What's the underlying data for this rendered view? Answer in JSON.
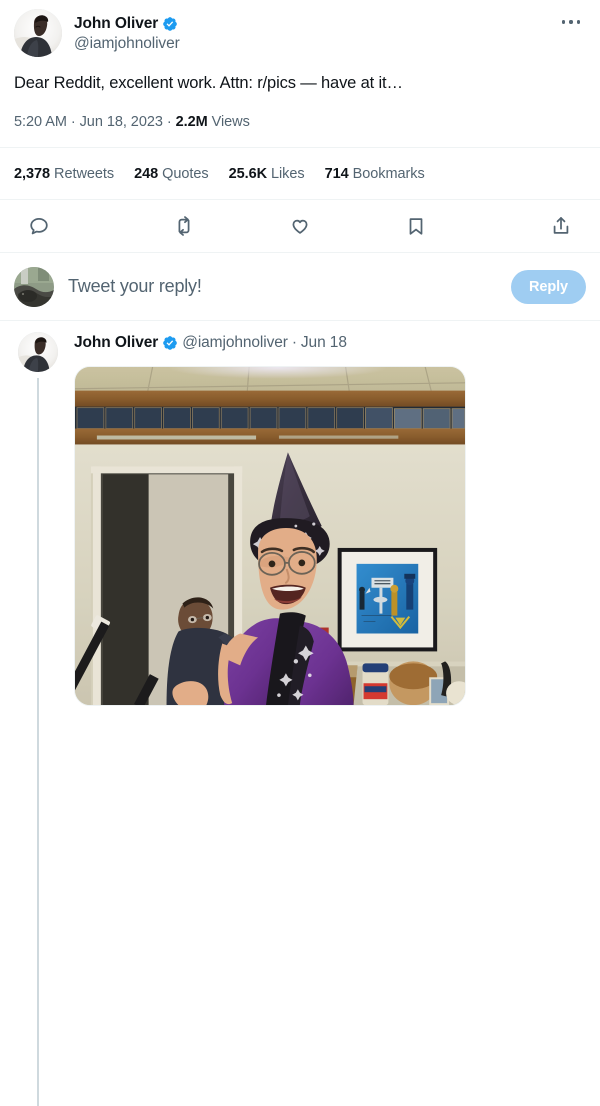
{
  "main_tweet": {
    "author": {
      "display_name": "John Oliver",
      "handle": "@iamjohnoliver",
      "verified_badge": "verified-icon",
      "avatar": "avatar-john-oliver"
    },
    "more_menu": "more-options-icon",
    "text": "Dear Reddit, excellent work. Attn: r/pics — have at it…",
    "meta": {
      "time": "5:20 AM",
      "separator_1": "·",
      "date": "Jun 18, 2023",
      "separator_2": "·",
      "views_count": "2.2M",
      "views_label": "Views"
    },
    "stats": [
      {
        "count": "2,378",
        "label": "Retweets"
      },
      {
        "count": "248",
        "label": "Quotes"
      },
      {
        "count": "25.6K",
        "label": "Likes"
      },
      {
        "count": "714",
        "label": "Bookmarks"
      }
    ],
    "actions": [
      {
        "name": "reply-action",
        "icon": "comment-icon"
      },
      {
        "name": "retweet-action",
        "icon": "retweet-icon"
      },
      {
        "name": "like-action",
        "icon": "heart-icon"
      },
      {
        "name": "bookmark-action",
        "icon": "bookmark-icon"
      },
      {
        "name": "share-action",
        "icon": "share-icon"
      }
    ]
  },
  "composer": {
    "avatar": "avatar-current-user",
    "placeholder": "Tweet your reply!",
    "reply_button_label": "Reply"
  },
  "thread_tweet": {
    "author": {
      "display_name": "John Oliver",
      "handle": "@iamjohnoliver",
      "verified_badge": "verified-icon",
      "avatar": "avatar-john-oliver"
    },
    "separator": "·",
    "date": "Jun 18",
    "more_menu": "more-options-icon",
    "media": {
      "type": "photo",
      "alt": "Man in a purple and black wizard costume with pointed hat holding a magic wand, standing in an office kitchen; a second man stands behind him, a framed blue artwork hangs on the wall"
    }
  },
  "colors": {
    "accent_blue": "#1d9bf0",
    "verified_blue": "#1d9bf0",
    "reply_button_disabled": "#9fcdf2",
    "text_primary": "#0f1419",
    "text_secondary": "#536471",
    "divider": "#eff3f4",
    "thread_line": "#cfd9de"
  }
}
